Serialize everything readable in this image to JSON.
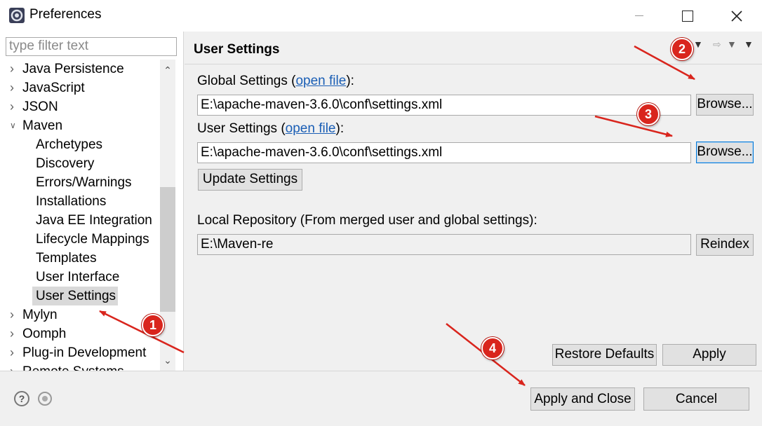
{
  "window": {
    "title": "Preferences",
    "minimize_icon": "minimize-icon",
    "maximize_icon": "maximize-icon",
    "close_glyph": "✕"
  },
  "sidebar": {
    "filter_placeholder": "type filter text",
    "items": [
      {
        "label": "Java Persistence",
        "expandable": true,
        "expanded": false,
        "level": 0
      },
      {
        "label": "JavaScript",
        "expandable": true,
        "expanded": false,
        "level": 0
      },
      {
        "label": "JSON",
        "expandable": true,
        "expanded": false,
        "level": 0
      },
      {
        "label": "Maven",
        "expandable": true,
        "expanded": true,
        "level": 0
      },
      {
        "label": "Archetypes",
        "level": 1
      },
      {
        "label": "Discovery",
        "level": 1
      },
      {
        "label": "Errors/Warnings",
        "level": 1
      },
      {
        "label": "Installations",
        "level": 1
      },
      {
        "label": "Java EE Integration",
        "level": 1
      },
      {
        "label": "Lifecycle Mappings",
        "level": 1
      },
      {
        "label": "Templates",
        "level": 1
      },
      {
        "label": "User Interface",
        "level": 1
      },
      {
        "label": "User Settings",
        "level": 1,
        "selected": true
      },
      {
        "label": "Mylyn",
        "expandable": true,
        "expanded": false,
        "level": 0
      },
      {
        "label": "Oomph",
        "expandable": true,
        "expanded": false,
        "level": 0
      },
      {
        "label": "Plug-in Development",
        "expandable": true,
        "expanded": false,
        "level": 0
      },
      {
        "label": "Remote Systems",
        "expandable": true,
        "expanded": false,
        "level": 0
      }
    ]
  },
  "main": {
    "title": "User Settings",
    "global_settings_label": "Global Settings (",
    "global_settings_link": "open file",
    "global_settings_suffix": "):",
    "global_settings_value": "E:\\apache-maven-3.6.0\\conf\\settings.xml",
    "global_browse": "Browse...",
    "user_settings_label": "User Settings (",
    "user_settings_link": "open file",
    "user_settings_suffix": "):",
    "user_settings_value": "E:\\apache-maven-3.6.0\\conf\\settings.xml",
    "user_browse": "Browse...",
    "update_settings": "Update Settings",
    "local_repo_label": "Local Repository (From merged user and global settings):",
    "local_repo_value": "E:\\Maven-re",
    "reindex": "Reindex",
    "restore_defaults": "Restore Defaults",
    "apply": "Apply"
  },
  "footer": {
    "help_glyph": "?",
    "apply_and_close": "Apply and Close",
    "cancel": "Cancel"
  },
  "annotations": {
    "color": "#d9251d",
    "badges": [
      "1",
      "2",
      "3",
      "4"
    ]
  }
}
